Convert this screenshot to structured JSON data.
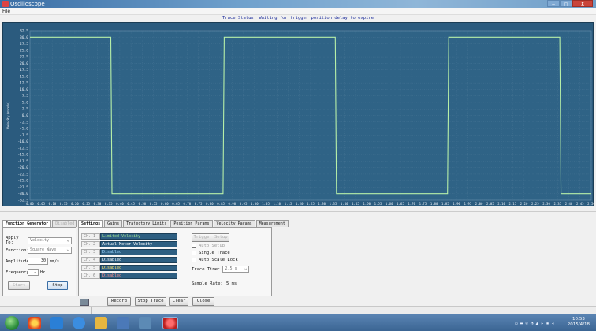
{
  "window": {
    "title": "Oscilloscope",
    "min": "—",
    "max": "□",
    "close": "X"
  },
  "menu": {
    "file": "File"
  },
  "scope": {
    "trace_status": "Trace Status:  Waiting for trigger position delay to expire",
    "ylabel": "Velocity (mm/s)",
    "xlabel": "Time (seconds)"
  },
  "chart_data": {
    "type": "line",
    "title": "",
    "xlabel": "Time (seconds)",
    "ylabel": "Velocity (mm/s)",
    "xlim": [
      0,
      2.5
    ],
    "ylim": [
      -32.5,
      32.5
    ],
    "grid": true,
    "x_ticks": [
      "0.00",
      "0.05",
      "0.10",
      "0.15",
      "0.20",
      "0.25",
      "0.30",
      "0.35",
      "0.40",
      "0.45",
      "0.50",
      "0.55",
      "0.60",
      "0.65",
      "0.70",
      "0.75",
      "0.80",
      "0.85",
      "0.90",
      "0.95",
      "1.00",
      "1.05",
      "1.10",
      "1.15",
      "1.20",
      "1.25",
      "1.30",
      "1.35",
      "1.40",
      "1.45",
      "1.50",
      "1.55",
      "1.60",
      "1.65",
      "1.70",
      "1.75",
      "1.80",
      "1.85",
      "1.90",
      "1.95",
      "2.00",
      "2.05",
      "2.10",
      "2.15",
      "2.20",
      "2.25",
      "2.30",
      "2.35",
      "2.40",
      "2.45",
      "2.50"
    ],
    "y_ticks": [
      "32.5",
      "30.0",
      "27.5",
      "25.0",
      "22.5",
      "20.0",
      "17.5",
      "15.0",
      "12.5",
      "10.0",
      "7.5",
      "5.0",
      "2.5",
      "0.0",
      "-2.5",
      "-5.0",
      "-7.5",
      "-10.0",
      "-12.5",
      "-15.0",
      "-17.5",
      "-20.0",
      "-22.5",
      "-25.0",
      "-27.5",
      "-30.0",
      "-32.5"
    ],
    "series": [
      {
        "color": "#b8f0a8",
        "x": [
          0.0,
          0.36,
          0.365,
          0.86,
          0.865,
          1.36,
          1.365,
          1.86,
          1.865,
          2.36,
          2.365,
          2.5
        ],
        "y": [
          30.0,
          30.0,
          -30.0,
          -30.0,
          30.0,
          30.0,
          -30.0,
          -30.0,
          30.0,
          30.0,
          -30.0,
          -30.0
        ]
      }
    ]
  },
  "fg": {
    "tab_function_generator": "Function Generator",
    "tab_disabled": "Disabled",
    "apply_to_label": "Apply To:",
    "apply_to_value": "Velocity",
    "function_label": "Function:",
    "function_value": "Square Wave",
    "amplitude_label": "Amplitude:",
    "amplitude_value": "30",
    "amplitude_unit": "mm/s",
    "frequency_label": "Frequency:",
    "frequency_value": "1",
    "frequency_unit": "Hz",
    "start": "Start",
    "stop": "Stop"
  },
  "settings": {
    "tabs": [
      "Settings",
      "Gains",
      "Trajectory Limits",
      "Position Params",
      "Velocity Params",
      "Measurement"
    ],
    "channels": [
      {
        "label": "Ch. 1",
        "value": "Limited Velocity",
        "color": "#9fe090"
      },
      {
        "label": "Ch. 2",
        "value": "Actual Motor Velocity",
        "color": "#ffffff"
      },
      {
        "label": "Ch. 3",
        "value": "Disabled",
        "color": "#9ad4ff"
      },
      {
        "label": "Ch. 4",
        "value": "Disabled",
        "color": "#ffffff"
      },
      {
        "label": "Ch. 5",
        "value": "Disabled",
        "color": "#ffe26a"
      },
      {
        "label": "Ch. 6",
        "value": "Disabled",
        "color": "#ff8d8d"
      }
    ],
    "trigger_setup": "Trigger Setup",
    "auto_setup": "Auto Setup",
    "single_trace": "Single Trace",
    "auto_scale_lock": "Auto Scale Lock",
    "trace_time_label": "Trace Time:",
    "trace_time_value": "2.5 s",
    "sample_rate_label": "Sample Rate:",
    "sample_rate_value": "5 ms"
  },
  "bottom_buttons": {
    "record": "Record",
    "stop_trace": "Stop Trace",
    "clear": "Clear",
    "close": "Close"
  },
  "taskbar": {
    "time": "10:53",
    "date": "2015/4/18"
  }
}
